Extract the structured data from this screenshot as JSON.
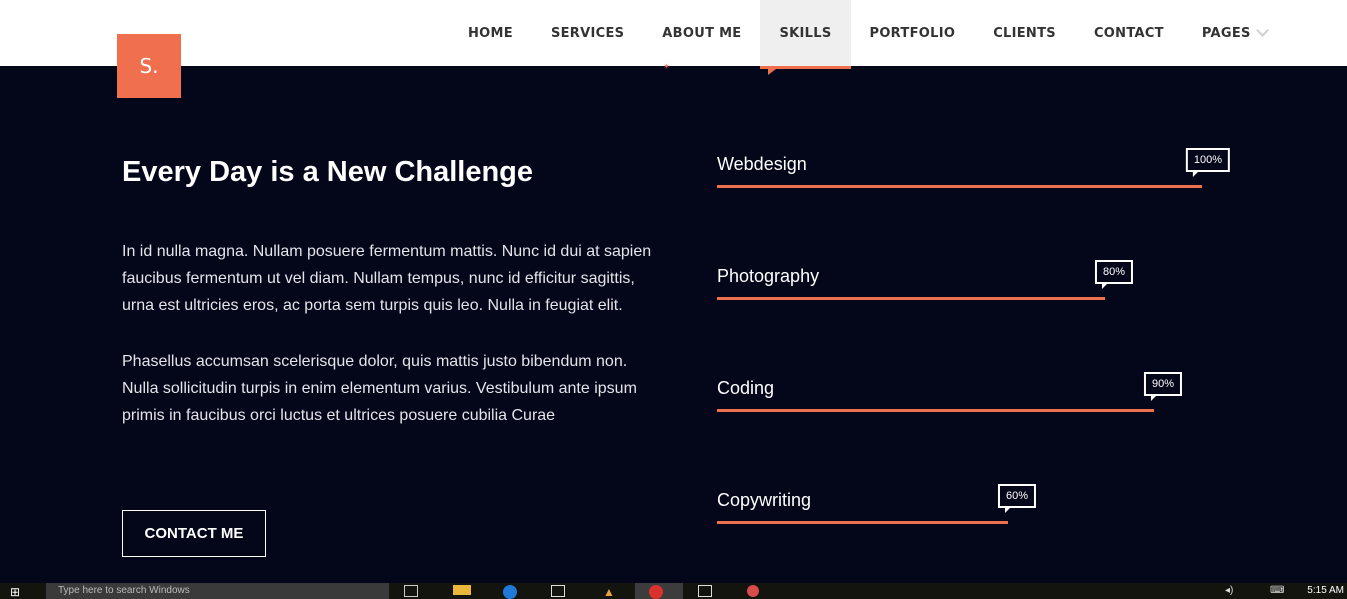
{
  "logo": {
    "text": "S."
  },
  "nav": {
    "items": [
      {
        "label": "HOME"
      },
      {
        "label": "SERVICES"
      },
      {
        "label": "ABOUT ME"
      },
      {
        "label": "SKILLS"
      },
      {
        "label": "PORTFOLIO"
      },
      {
        "label": "CLIENTS"
      },
      {
        "label": "CONTACT"
      },
      {
        "label": "PAGES"
      }
    ],
    "active": "SKILLS"
  },
  "intro": {
    "title": "Every Day is a New Challenge",
    "paragraph1": "In id nulla magna. Nullam posuere fermentum mattis. Nunc id dui at sapien faucibus fermentum ut vel diam. Nullam tempus, nunc id efficitur sagittis, urna est ultricies eros, ac porta sem turpis quis leo. Nulla in feugiat elit.",
    "paragraph2": "Phasellus accumsan scelerisque dolor, quis mattis justo bibendum non. Nulla sollicitudin turpis in enim elementum varius. Vestibulum ante ipsum primis in faucibus orci luctus et ultrices posuere cubilia Curae",
    "button_label": "CONTACT ME"
  },
  "skills": [
    {
      "label": "Webdesign",
      "percent_text": "100%",
      "value": 100
    },
    {
      "label": "Photography",
      "percent_text": "80%",
      "value": 80
    },
    {
      "label": "Coding",
      "percent_text": "90%",
      "value": 90
    },
    {
      "label": "Copywriting",
      "percent_text": "60%",
      "value": 60
    }
  ],
  "taskbar": {
    "search_placeholder": "Type here to search Windows",
    "clock": "5:15 AM"
  },
  "colors": {
    "accent": "#f06f4f",
    "background": "#04061a",
    "header": "#ffffff"
  }
}
